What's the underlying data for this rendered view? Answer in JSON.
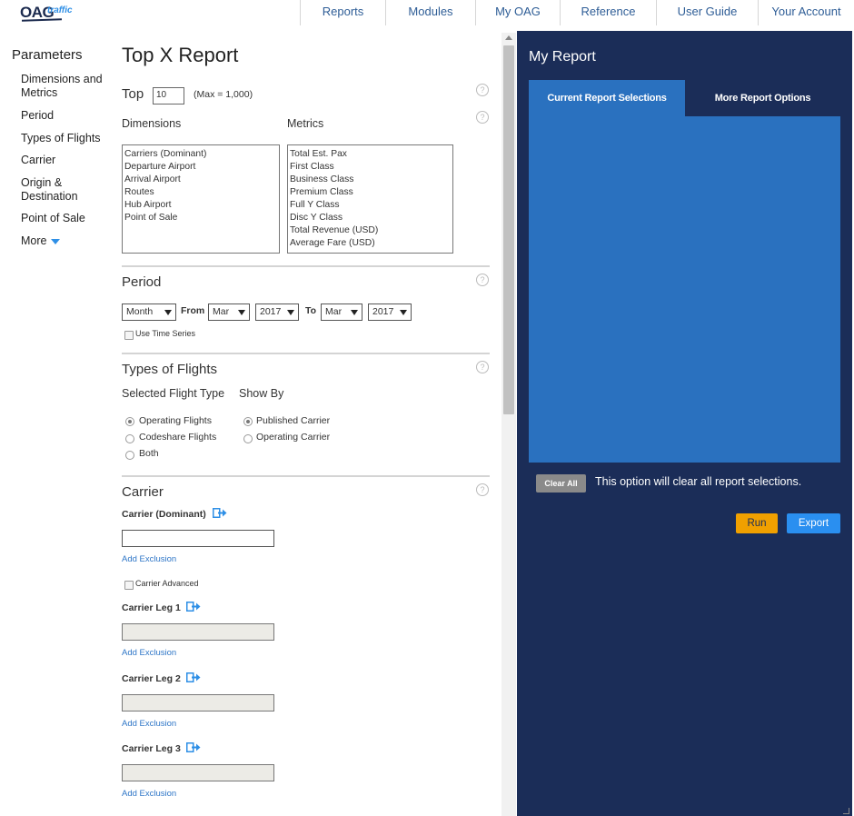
{
  "logo": {
    "main": "OAG",
    "sub": "traffic"
  },
  "nav": {
    "items": [
      "Reports",
      "Modules",
      "My OAG",
      "Reference",
      "User Guide",
      "Your Account"
    ]
  },
  "sidebar": {
    "title": "Parameters",
    "items": [
      "Dimensions and Metrics",
      "Period",
      "Types of Flights",
      "Carrier",
      "Origin & Destination",
      "Point of Sale",
      "More"
    ]
  },
  "main": {
    "title": "Top X Report",
    "top": {
      "label": "Top",
      "value": "10",
      "max_note": "(Max = 1,000)"
    },
    "dimensions": {
      "label": "Dimensions",
      "items": [
        "Carriers (Dominant)",
        "Departure Airport",
        "Arrival Airport",
        "Routes",
        "Hub Airport",
        "Point of Sale"
      ]
    },
    "metrics": {
      "label": "Metrics",
      "items": [
        "Total Est. Pax",
        "First Class",
        "Business Class",
        "Premium Class",
        "Full Y Class",
        "Disc Y Class",
        "Total Revenue (USD)",
        "Average Fare (USD)"
      ]
    },
    "period": {
      "title": "Period",
      "granularity": "Month",
      "from_label": "From",
      "from_month": "Mar",
      "from_year": "2017",
      "to_label": "To",
      "to_month": "Mar",
      "to_year": "2017",
      "time_series_label": "Use Time Series"
    },
    "flights": {
      "title": "Types of Flights",
      "selected_label": "Selected Flight Type",
      "showby_label": "Show By",
      "types": [
        "Operating Flights",
        "Codeshare Flights",
        "Both"
      ],
      "showby": [
        "Published Carrier",
        "Operating Carrier"
      ]
    },
    "carrier": {
      "title": "Carrier",
      "dominant_label": "Carrier (Dominant)",
      "add_exclusion": "Add Exclusion",
      "advanced_label": "Carrier Advanced",
      "legs": [
        "Carrier Leg 1",
        "Carrier Leg 2",
        "Carrier Leg 3"
      ]
    },
    "help_glyph": "?"
  },
  "report": {
    "title": "My Report",
    "tabs": [
      "Current Report Selections",
      "More Report Options"
    ],
    "clear_all": "Clear All",
    "clear_text": "This option will clear all report selections.",
    "run": "Run",
    "export": "Export"
  },
  "colors": {
    "panel_bg": "#1b2d58",
    "accent_blue": "#2a71bf",
    "run": "#f0a000",
    "export": "#2a8ff0",
    "link": "#2e76c7"
  }
}
